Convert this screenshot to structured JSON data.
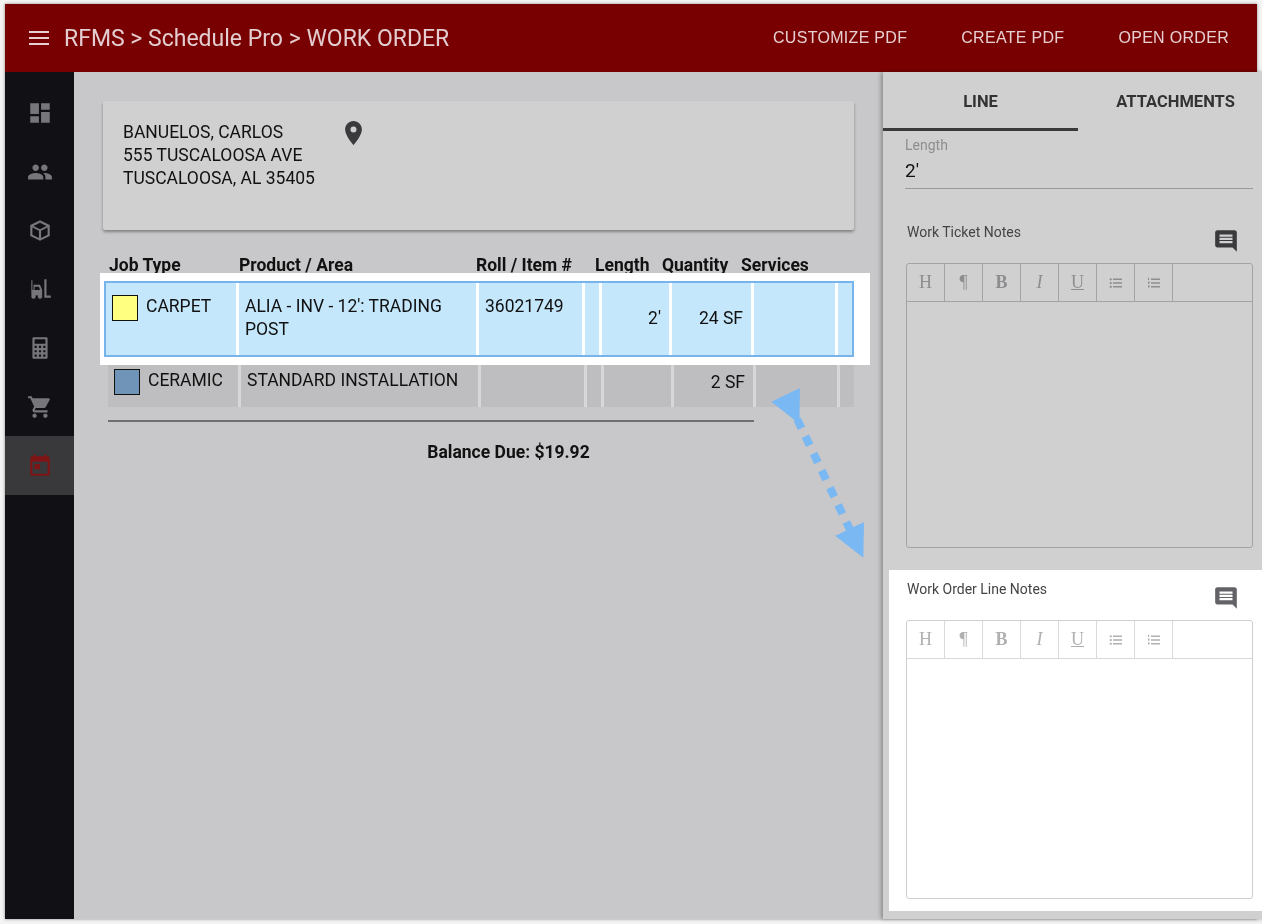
{
  "header": {
    "title": "RFMS > Schedule Pro > WORK ORDER",
    "actions": [
      "CUSTOMIZE PDF",
      "CREATE PDF",
      "OPEN ORDER"
    ]
  },
  "sidebar": {
    "items": [
      {
        "kind": "dashboard",
        "selected": false
      },
      {
        "kind": "people",
        "selected": false
      },
      {
        "kind": "box",
        "selected": false
      },
      {
        "kind": "forklift",
        "selected": false
      },
      {
        "kind": "calculator",
        "selected": false
      },
      {
        "kind": "cart",
        "selected": false
      },
      {
        "kind": "calendar",
        "selected": true
      }
    ]
  },
  "customer": {
    "lines": [
      "BANUELOS, CARLOS",
      "555 TUSCALOOSA AVE",
      "TUSCALOOSA, AL 35405"
    ]
  },
  "table": {
    "columns": [
      "Job Type",
      "Product / Area",
      "Roll / Item #",
      "Length",
      "Quantity",
      "Services"
    ],
    "rows": [
      {
        "job_type": "CARPET",
        "color": "#ffff80",
        "product": "ALIA - INV - 12': TRADING POST",
        "roll": "36021749",
        "length": "2'",
        "quantity": "24 SF",
        "highlighted": true
      },
      {
        "job_type": "CERAMIC",
        "color": "#7094b8",
        "product": "STANDARD INSTALLATION",
        "quantity": "2 SF",
        "highlighted": false
      }
    ]
  },
  "balance": "Balance Due: $19.92",
  "panel": {
    "tabs": [
      {
        "label": "LINE",
        "selected": true
      },
      {
        "label": "ATTACHMENTS",
        "selected": false
      }
    ],
    "length": {
      "label": "Length",
      "value": "2'"
    },
    "editors": [
      {
        "label": "Work Ticket Notes",
        "highlighted": false,
        "toolbar": [
          "H",
          "¶",
          "B",
          "I",
          "U"
        ]
      },
      {
        "label": "Work Order Line Notes",
        "highlighted": true,
        "toolbar": [
          "H",
          "¶",
          "B",
          "I",
          "U"
        ]
      }
    ]
  }
}
